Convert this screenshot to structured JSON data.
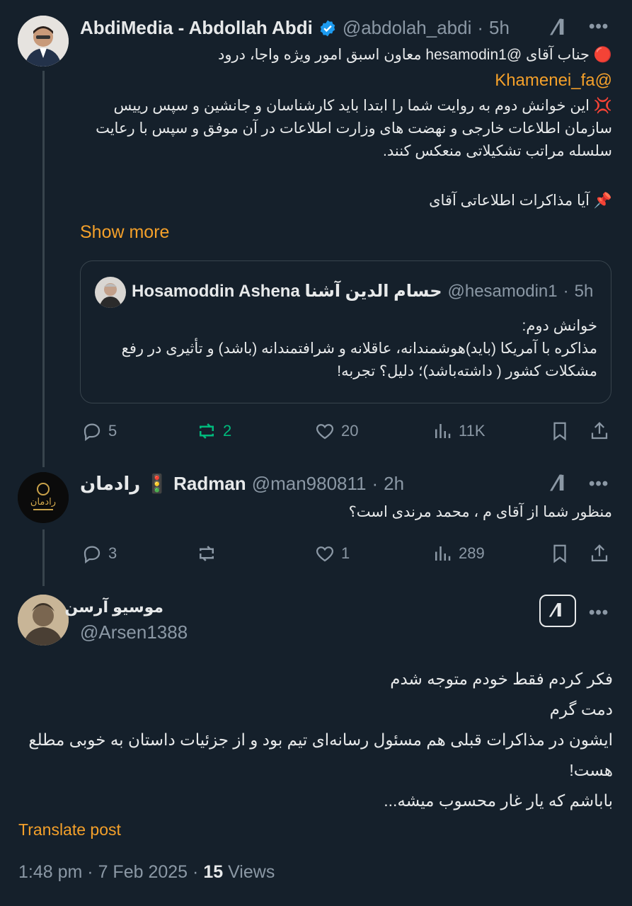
{
  "tweet1": {
    "display_name": "AbdiMedia - Abdollah Abdi",
    "handle": "@abdolah_abdi",
    "time": "5h",
    "lines": [
      "🔴 جناب آقای @hesamodin1 معاون اسبق امور ویژه واجا، درود",
      "@Khamenei_fa",
      "💢 این خوانش دوم به روایت شما را ابتدا باید کارشناسان و جانشین و سپس رییس",
      "سازمان اطلاعات خارجی و نهضت های وزارت اطلاعات در آن موفق و سپس با رعایت",
      "سلسله مراتب تشکیلاتی منعکس کنند.",
      "📌 آیا مذاکرات اطلاعاتی آقای"
    ],
    "show_more": "Show more",
    "quote": {
      "name": "Hosamoddin Ashena حسام الدین آشنا",
      "handle": "@hesamodin1",
      "time": "5h",
      "lines": [
        "خوانش دوم:",
        "مذاکره با آمریکا (باید)هوشمندانه، عاقلانه و شرافتمندانه (باشد) و  تأثیری در رفع",
        "مشکلات کشور ( داشته‌باشد)؛ دلیل؟ تجربه!"
      ]
    },
    "actions": {
      "replies": "5",
      "reposts": "2",
      "likes": "20",
      "views": "11K"
    }
  },
  "tweet2": {
    "display_name": "رادمان 🚦 Radman",
    "handle": "@man980811",
    "time": "2h",
    "text": "منظور شما از آقای م ، محمد مرندی است؟",
    "actions": {
      "replies": "3",
      "reposts": "",
      "likes": "1",
      "views": "289"
    }
  },
  "main": {
    "display_name": "موسیو آرسن",
    "handle": "@Arsen1388",
    "lines": [
      "فکر کردم فقط خودم متوجه شدم",
      "دمت گرم",
      "ایشون در مذاکرات قبلی هم مسئول رسانه‌ای تیم بود و از جزئیات داستان به خوبی مطلع",
      "هست!",
      "باباشم که یار غار محسوب میشه..."
    ],
    "translate": "Translate post",
    "time": "1:48 pm",
    "date": "7 Feb 2025",
    "views_count": "15",
    "views_label": "Views"
  },
  "colors": {
    "background": "#15202b",
    "accent_orange": "#f4a02a",
    "repost_green": "#00ba7c",
    "verified_blue": "#1d9bf0",
    "muted": "#8b98a5"
  },
  "icons": [
    "verified-icon",
    "grok-icon",
    "more-icon",
    "reply-icon",
    "repost-icon",
    "like-icon",
    "views-icon",
    "bookmark-icon",
    "share-icon"
  ]
}
